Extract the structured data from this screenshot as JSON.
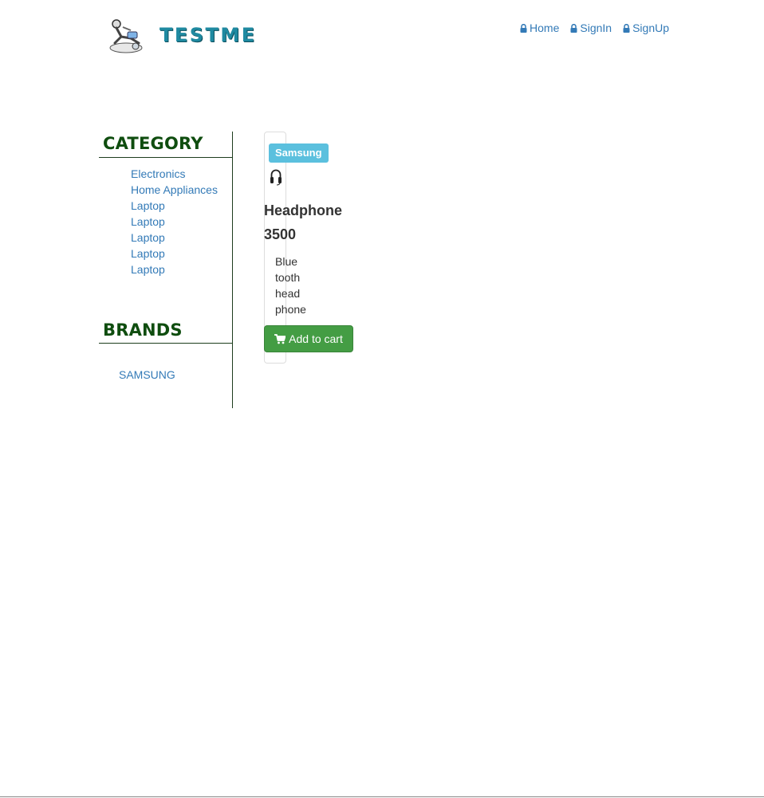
{
  "header": {
    "logo_text": "TESTME",
    "nav": [
      {
        "label": "Home",
        "icon": "lock-icon"
      },
      {
        "label": "SignIn",
        "icon": "lock-icon"
      },
      {
        "label": "SignUp",
        "icon": "lock-icon"
      }
    ]
  },
  "sidebar": {
    "category_title": "CATEGORY",
    "categories": [
      "Electronics",
      "Home Appliances",
      "Laptop",
      "Laptop",
      "Laptop",
      "Laptop",
      "Laptop"
    ],
    "brands_title": "BRANDS",
    "brands": [
      "SAMSUNG"
    ]
  },
  "product": {
    "brand_badge": "Samsung",
    "image_icon": "headphone-icon",
    "name": "Headphone 3500",
    "description": "Blue tooth head phone",
    "add_to_cart_label": "Add to cart",
    "cart_icon": "shopping-cart-icon"
  },
  "colors": {
    "link": "#337ab7",
    "logo": "#1f8aa1",
    "sidebar_heading": "#0f4d0f",
    "badge": "#5bc0de",
    "button": "#449d44"
  }
}
